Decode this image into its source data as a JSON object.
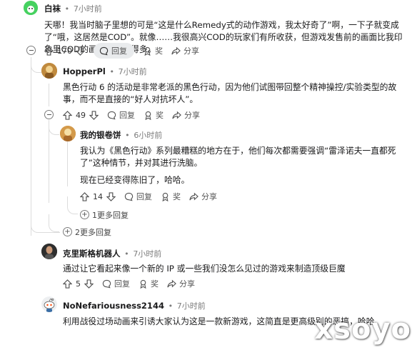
{
  "comments": [
    {
      "username": "白袜",
      "time": "7小时前",
      "text": "天哪！我当时脑子里想的可是“这是什么Remedy式的动作游戏，我太好奇了”啊，一下子就变成了“哦，这居然是COD”。就像……我很高兴COD的玩家们有所收获，但游戏发售前的画面比我印象里COD的画面要酷炫得多。",
      "votes": "170",
      "reply_label": "回复",
      "award_label": "奖",
      "share_label": "分享"
    },
    {
      "username": "HopperPl",
      "time": "7小时前",
      "text": "黑色行动 6 的活动是非常老派的黑色行动，因为他们试图带回整个精神操控/实验类型的故事，而不是直接的“好人对抗坏人”。",
      "votes": "49",
      "reply_label": "回复",
      "award_label": "奖",
      "share_label": "分享"
    },
    {
      "username": "我的银卷饼",
      "time": "6小时前",
      "text": "我认为《黑色行动》系列最糟糕的地方在于，他们每次都需要强调“雷泽诺夫一直都死了”这种情节，并对其进行洗脑。",
      "text2": "现在已经变得陈旧了，哈哈。",
      "votes": "14",
      "reply_label": "回复",
      "award_label": "奖",
      "share_label": "分享",
      "more_replies": "1更多回复"
    },
    {
      "more_replies": "2更多回复"
    },
    {
      "username": "克里斯格机器人",
      "time": "7小时前",
      "text": "通过让它看起来像一个新的 IP 或一些我们没怎么见过的游戏来制造顶级巨魔",
      "votes": "5",
      "reply_label": "回复",
      "award_label": "奖",
      "share_label": "分享"
    },
    {
      "username": "NoNefariousness2144",
      "time": "7小时前",
      "text": "利用战役过场动画来引诱大家认为这是一款新游戏，这简直是更高级别的恶搞，哈哈"
    }
  ],
  "separator": "•",
  "watermark": "xsoyo",
  "colors": {
    "avatar1": "#46d160",
    "avatar2": "#c08a3e",
    "avatar3": "#d49a4a",
    "reply_pill": "#e9ebed"
  }
}
